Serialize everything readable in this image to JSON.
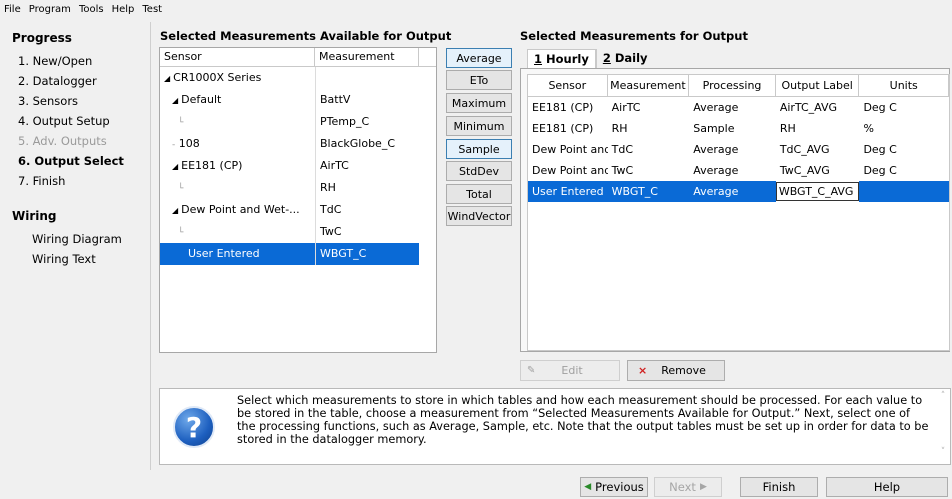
{
  "menu": [
    "File",
    "Program",
    "Tools",
    "Help",
    "Test"
  ],
  "progress": {
    "title": "Progress",
    "steps": [
      {
        "label": "1. New/Open"
      },
      {
        "label": "2. Datalogger"
      },
      {
        "label": "3. Sensors"
      },
      {
        "label": "4. Output Setup"
      },
      {
        "label": "5. Adv. Outputs"
      },
      {
        "label": "6. Output Select"
      },
      {
        "label": "7. Finish"
      }
    ]
  },
  "wiring": {
    "title": "Wiring",
    "links": [
      "Wiring Diagram",
      "Wiring Text"
    ]
  },
  "available": {
    "title": "Selected Measurements Available for Output",
    "headers": [
      "Sensor",
      "Measurement"
    ],
    "rows": [
      {
        "sensor": "CR1000X Series",
        "measurement": ""
      },
      {
        "sensor": "Default",
        "measurement": "BattV"
      },
      {
        "sensor": "",
        "measurement": "PTemp_C"
      },
      {
        "sensor": "108",
        "measurement": "BlackGlobe_C"
      },
      {
        "sensor": "EE181 (CP)",
        "measurement": "AirTC"
      },
      {
        "sensor": "",
        "measurement": "RH"
      },
      {
        "sensor": "Dew Point and Wet-...",
        "measurement": "TdC"
      },
      {
        "sensor": "",
        "measurement": "TwC"
      },
      {
        "sensor": "User Entered",
        "measurement": "WBGT_C"
      }
    ]
  },
  "functions": [
    "Average",
    "ETo",
    "Maximum",
    "Minimum",
    "Sample",
    "StdDev",
    "Total",
    "WindVector"
  ],
  "output": {
    "title": "Selected Measurements for Output",
    "tabs": [
      {
        "key": "1",
        "label": " Hourly"
      },
      {
        "key": "2",
        "label": " Daily"
      }
    ],
    "headers": [
      "Sensor",
      "Measurement",
      "Processing",
      "Output Label",
      "Units"
    ],
    "rows": [
      {
        "sensor": "EE181 (CP)",
        "measurement": "AirTC",
        "processing": "Average",
        "label": "AirTC_AVG",
        "units": "Deg C"
      },
      {
        "sensor": "EE181 (CP)",
        "measurement": "RH",
        "processing": "Sample",
        "label": "RH",
        "units": "%"
      },
      {
        "sensor": "Dew Point and",
        "measurement": "TdC",
        "processing": "Average",
        "label": "TdC_AVG",
        "units": "Deg C"
      },
      {
        "sensor": "Dew Point and",
        "measurement": "TwC",
        "processing": "Average",
        "label": "TwC_AVG",
        "units": "Deg C"
      },
      {
        "sensor": "User Entered",
        "measurement": "WBGT_C",
        "processing": "Average",
        "label": "WBGT_C_AVG",
        "units": ""
      }
    ],
    "edit_label": "Edit",
    "remove_label": "Remove"
  },
  "help_text": "Select which measurements to store in which tables and how each measurement should be processed. For each value to be stored in the table, choose a measurement from “Selected Measurements Available for Output.” Next, select one of the processing functions, such as Average, Sample, etc. Note that the output tables must be set up in order for data to be stored in the datalogger memory.",
  "nav": {
    "previous": "Previous",
    "next": "Next",
    "finish": "Finish",
    "help": "Help"
  }
}
